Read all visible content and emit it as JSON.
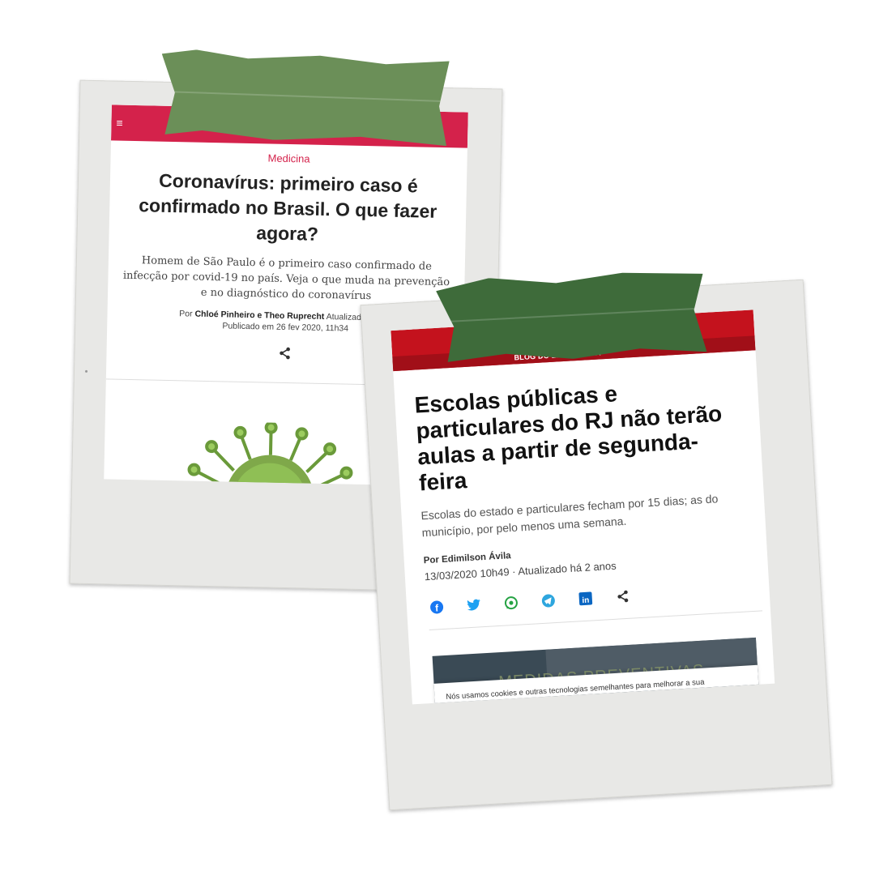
{
  "card1": {
    "category": "Medicina",
    "headline": "Coronavírus: primeiro caso é confirmado no Brasil. O que fazer agora?",
    "subheadline": "Homem de São Paulo é o primeiro caso confirmado de infecção por covid-19 no país. Veja o que muda na prevenção e no diagnóstico do coronavírus",
    "byline_prefix": "Por",
    "authors": "Chloé Pinheiro e Theo Ruprecht",
    "updated": "Atualizado em 18",
    "published": "Publicado em 26 fev 2020, 11h34",
    "menu_icon": "hamburger-icon",
    "share_icon": "share-icon",
    "brand_color": "#d4224b"
  },
  "card2": {
    "section": "BLOG DO EDIMILSON Á",
    "headline": "Escolas públicas e particulares do RJ não terão aulas a partir de segunda-feira",
    "subheadline": "Escolas do estado e particulares fecham por 15 dias; as do município, por pelo menos uma semana.",
    "author": "Por Edimilson Ávila",
    "date": "13/03/2020 10h49 · Atualizado há 2 anos",
    "image_text": "MEDIDAS PREVENTIVAS",
    "cookie_text": "Nós usamos cookies e outras tecnologias semelhantes para melhorar a sua",
    "brand_color": "#c4121d",
    "share_icons": [
      "facebook-icon",
      "twitter-icon",
      "whatsapp-icon",
      "telegram-icon",
      "linkedin-icon",
      "share-icon"
    ]
  }
}
